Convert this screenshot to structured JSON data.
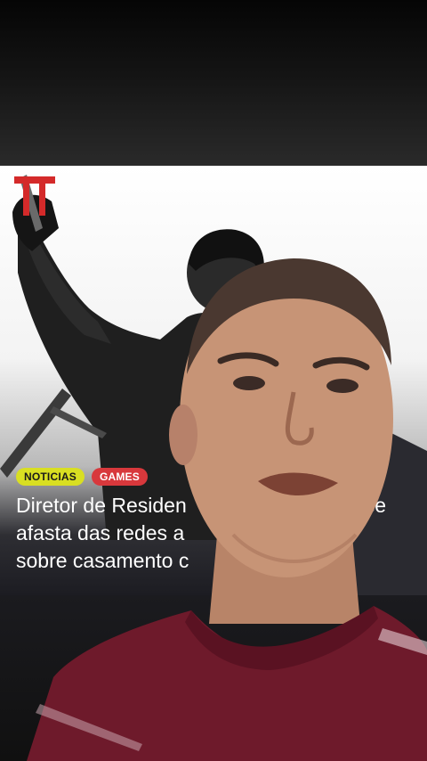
{
  "article": {
    "tags": [
      "NOTICIAS",
      "GAMES"
    ],
    "headline_lines": [
      {
        "before": "Diretor de Residen",
        "after": "se"
      },
      {
        "before": "afasta das redes a",
        "after": ""
      },
      {
        "before": "sobre casamento c",
        "after": ""
      }
    ]
  },
  "colors": {
    "tag_noticias": "#d9df22",
    "tag_games": "#d8383c",
    "logo_red": "#d42a2a",
    "shirt": "#6e1a2b"
  },
  "icons": {
    "site_logo": "red-T-logo-icon"
  }
}
